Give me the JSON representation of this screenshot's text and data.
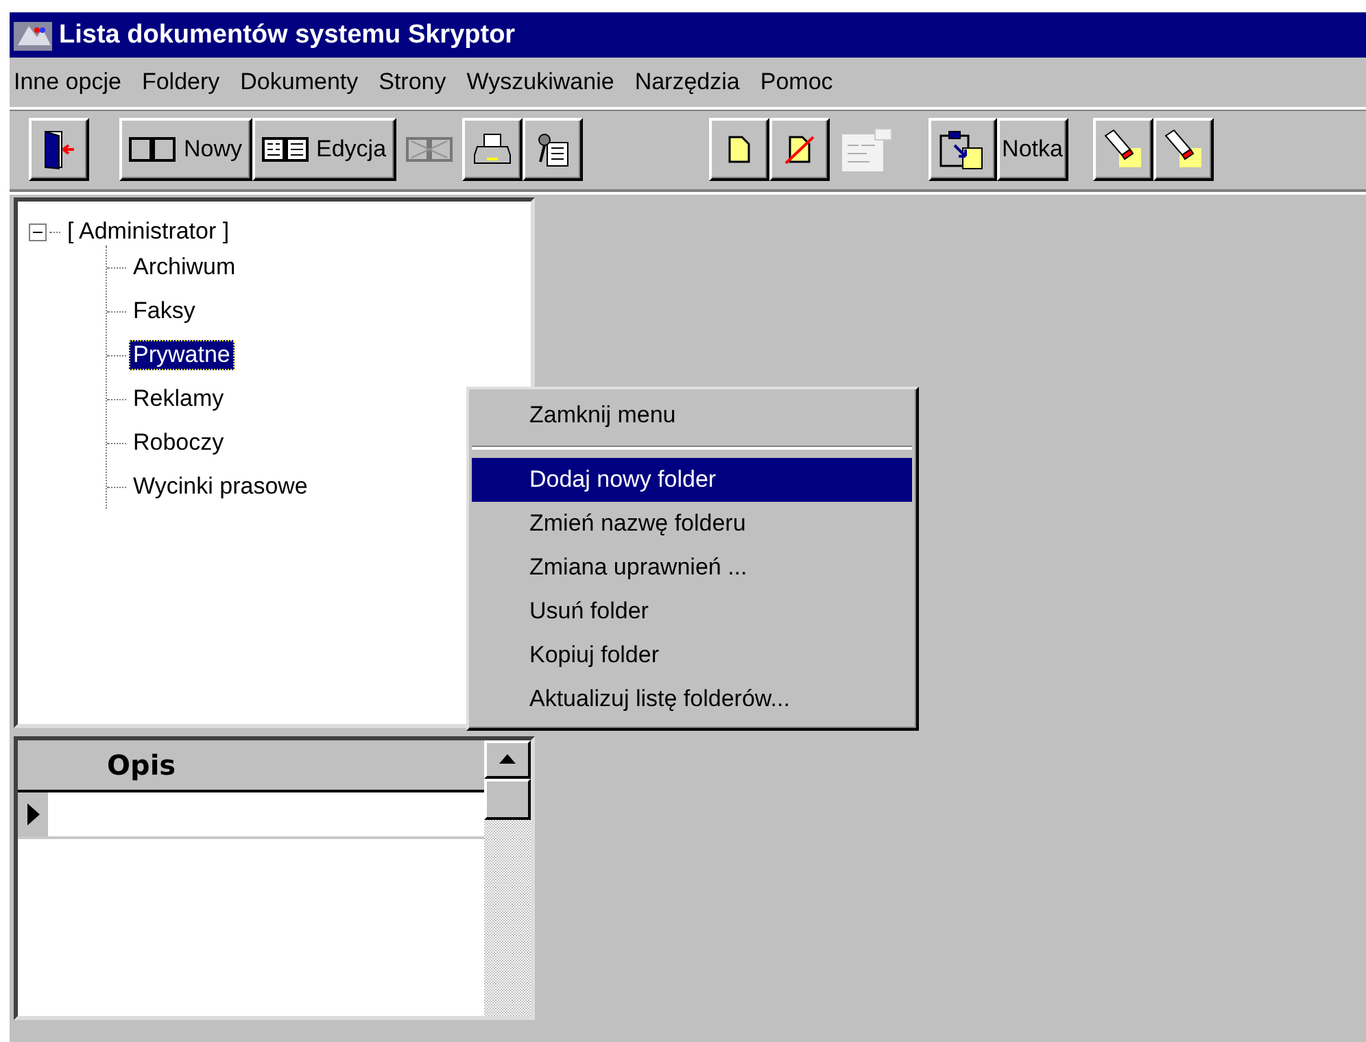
{
  "window": {
    "title": "Lista dokumentów systemu Skryptor"
  },
  "menu_bar": [
    "Inne opcje",
    "Foldery",
    "Dokumenty",
    "Strony",
    "Wyszukiwanie",
    "Narzędzia",
    "Pomoc"
  ],
  "toolbar": [
    [
      {
        "kind": "door",
        "disabled": false
      }
    ],
    [
      {
        "kind": "pages",
        "label": "Nowy",
        "disabled": false
      },
      {
        "kind": "pages-lined",
        "label": "Edycja",
        "disabled": false
      },
      {
        "kind": "pages-crossed",
        "disabled": true
      },
      {
        "kind": "printer",
        "disabled": false
      },
      {
        "kind": "tool",
        "disabled": false
      }
    ],
    [
      {
        "kind": "doc",
        "disabled": false
      },
      {
        "kind": "doc-crossed",
        "disabled": false
      },
      {
        "kind": "doc-list",
        "disabled": true
      }
    ],
    [
      {
        "kind": "paste",
        "disabled": false
      },
      {
        "kind": "text",
        "label": "Notka",
        "disabled": false
      }
    ],
    [
      {
        "kind": "flashlight",
        "disabled": false
      },
      {
        "kind": "flashlight",
        "disabled": false
      }
    ]
  ],
  "tree": {
    "label": "[ Administrator ]",
    "expanded": true,
    "selected": false,
    "children": [
      {
        "label": "Archiwum",
        "selected": false
      },
      {
        "label": "Faksy",
        "selected": false
      },
      {
        "label": "Prywatne",
        "selected": true
      },
      {
        "label": "Reklamy",
        "selected": false
      },
      {
        "label": "Roboczy",
        "selected": false
      },
      {
        "label": "Wycinki prasowe",
        "selected": false
      }
    ]
  },
  "grid": {
    "columns": [
      "Opis"
    ],
    "rows": [
      {
        "current": true
      }
    ]
  },
  "context_menu": [
    {
      "kind": "item",
      "label": "Zamknij menu",
      "selected": false
    },
    {
      "kind": "separator"
    },
    {
      "kind": "item",
      "label": "Dodaj nowy folder",
      "selected": true
    },
    {
      "kind": "item",
      "label": "Zmień nazwę folderu",
      "selected": false
    },
    {
      "kind": "item",
      "label": "Zmiana uprawnień ...",
      "selected": false
    },
    {
      "kind": "item",
      "label": "Usuń folder",
      "selected": false
    },
    {
      "kind": "item",
      "label": "Kopiuj folder",
      "selected": false
    },
    {
      "kind": "item",
      "label": "Aktualizuj listę folderów...",
      "selected": false
    }
  ]
}
